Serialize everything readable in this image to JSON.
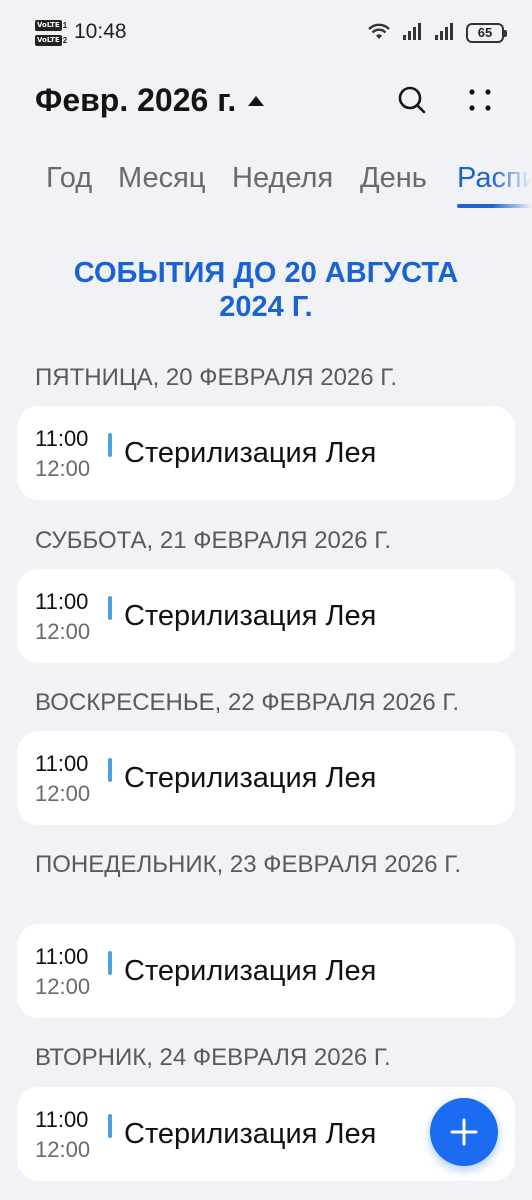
{
  "status_bar": {
    "time": "10:48",
    "sim1_tag": "VoLTE",
    "sim1_num": "1",
    "sim2_tag": "VoLTE",
    "sim2_num": "2",
    "battery": "65"
  },
  "header": {
    "month_title": "Февр. 2026 г.",
    "search_icon": "search-icon",
    "more_icon": "more-dots-icon"
  },
  "tabs": [
    {
      "label": "Год"
    },
    {
      "label": "Месяц"
    },
    {
      "label": "Неделя"
    },
    {
      "label": "День"
    },
    {
      "label": "Распи",
      "active": true
    }
  ],
  "events_until_line1": "СОБЫТИЯ ДО 20 АВГУСТА",
  "events_until_line2": "2024 Г.",
  "days": [
    {
      "header": "ПЯТНИЦА, 20 ФЕВРАЛЯ 2026 Г.",
      "event": {
        "start": "11:00",
        "end": "12:00",
        "title": "Стерилизация Лея"
      }
    },
    {
      "header": "СУББОТА, 21 ФЕВРАЛЯ 2026 Г.",
      "event": {
        "start": "11:00",
        "end": "12:00",
        "title": "Стерилизация Лея"
      }
    },
    {
      "header": "ВОСКРЕСЕНЬЕ, 22 ФЕВРАЛЯ 2026 Г.",
      "event": {
        "start": "11:00",
        "end": "12:00",
        "title": "Стерилизация Лея"
      }
    },
    {
      "header": "ПОНЕДЕЛЬНИК, 23 ФЕВРАЛЯ 2026 Г.",
      "event": {
        "start": "11:00",
        "end": "12:00",
        "title": "Стерилизация Лея"
      }
    },
    {
      "header": "ВТОРНИК, 24 ФЕВРАЛЯ 2026 Г.",
      "event": {
        "start": "11:00",
        "end": "12:00",
        "title": "Стерилизация Лея"
      }
    }
  ],
  "colors": {
    "accent": "#1a63d4",
    "event_bar": "#4da0e0",
    "fab": "#1a6bef",
    "background": "#f1f2f6"
  },
  "fab_icon": "plus-icon"
}
